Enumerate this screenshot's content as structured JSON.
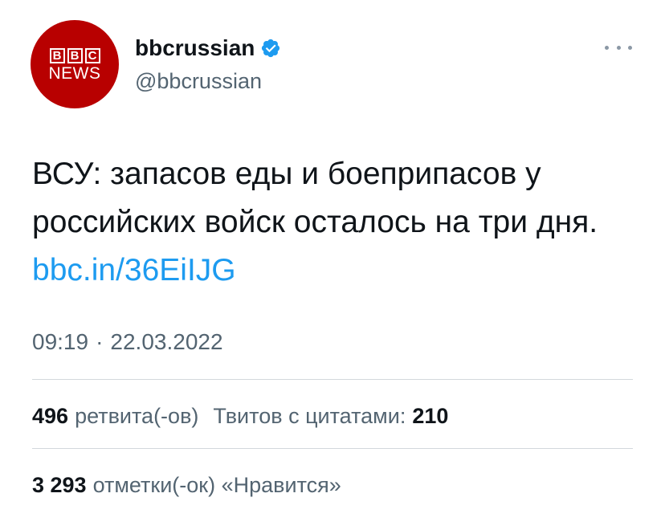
{
  "profile": {
    "logo_letters": [
      "B",
      "B",
      "C"
    ],
    "logo_sub": "NEWS",
    "display_name": "bbcrussian",
    "handle": "@bbcrussian",
    "verified_icon": "verified-badge-icon"
  },
  "tweet": {
    "text": "ВСУ: запасов еды и боеприпасов у российских войск осталось на три дня. ",
    "link": "bbc.in/36EiIJG",
    "time": "09:19",
    "separator": "·",
    "date": "22.03.2022"
  },
  "stats": {
    "retweets_count": "496",
    "retweets_label": "ретвита(-ов)",
    "quotes_label": "Твитов с цитатами:",
    "quotes_count": "210",
    "likes_count": "3 293",
    "likes_label": "отметки(-ок) «Нравится»"
  },
  "colors": {
    "bbc_red": "#b80000",
    "link_blue": "#1d9bf0",
    "muted_text": "#536471",
    "verified_blue": "#1d9bf0"
  }
}
